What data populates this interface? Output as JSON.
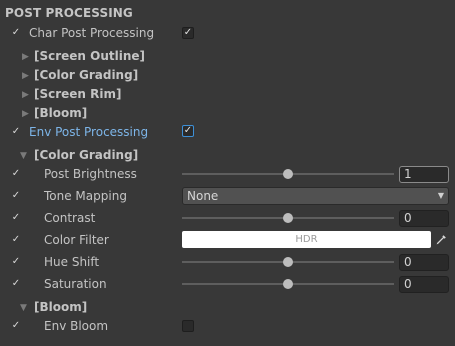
{
  "header": "POST PROCESSING",
  "char_pp": {
    "label": "Char Post Processing",
    "enabled": "✓"
  },
  "char_folds": [
    "[Screen Outline]",
    "[Color Grading]",
    "[Screen Rim]",
    "[Bloom]"
  ],
  "env_pp": {
    "label": "Env Post Processing",
    "enabled": "✓"
  },
  "color_grading": {
    "title": "[Color Grading]",
    "post_brightness": {
      "label": "Post Brightness",
      "value": "1",
      "level": 0.5
    },
    "tone_mapping": {
      "label": "Tone Mapping",
      "value": "None"
    },
    "contrast": {
      "label": "Contrast",
      "value": "0",
      "level": 0.5
    },
    "color_filter": {
      "label": "Color Filter",
      "value": "HDR",
      "color": "#ffffff"
    },
    "hue_shift": {
      "label": "Hue Shift",
      "value": "0",
      "level": 0.5
    },
    "saturation": {
      "label": "Saturation",
      "value": "0",
      "level": 0.5
    }
  },
  "bloom": {
    "title": "[Bloom]",
    "env_bloom": {
      "label": "Env Bloom"
    }
  },
  "icons": {
    "check": "✓",
    "fold_closed": "▶",
    "fold_open": "▼",
    "dropdown": "▼"
  }
}
